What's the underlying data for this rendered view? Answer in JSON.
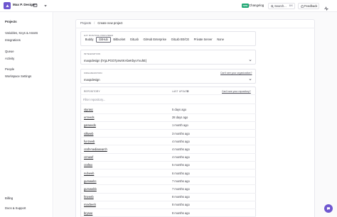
{
  "workspace": {
    "name": "Max P. Design"
  },
  "header": {
    "new_badge": "new",
    "changelog": "Changelog",
    "search_label": "Search...",
    "search_shortcut": "⌘K",
    "feedback": "Feedback"
  },
  "sidebar": {
    "projects": "Projects",
    "variables": "Variables, Keys & Assets",
    "integrations": "Integrations",
    "queue": "Queue",
    "activity": "Activity",
    "people": "People",
    "workspace_settings": "Workspace Settings",
    "billing": "Billing",
    "docs": "Docs & Support"
  },
  "breadcrumb": {
    "parent": "Projects",
    "separator": "/",
    "current": "Create new project"
  },
  "providers_card": {
    "label": "Git hosting provider",
    "options": [
      "Buddy",
      "GitHub",
      "Bitbucket",
      "GitLab",
      "GitHub Enterprise",
      "GitLab EE/CE",
      "Private Server",
      "None"
    ],
    "selected": "GitHub"
  },
  "integration_card": {
    "label": "Integration",
    "value": "maxpdesign (tYgLPGO7prwXKAbeKbyvYxuhE)"
  },
  "organization_card": {
    "label": "Organization",
    "value": "maxpdesign",
    "help_link": "Can't see your organization?"
  },
  "repositories": {
    "col_repo": "Repository",
    "col_updated": "Last update",
    "help_link": "Can't see your repository?",
    "filter_placeholder": "Filter repository...",
    "rows": [
      {
        "name": "styrasc",
        "updated": "5 days ago"
      },
      {
        "name": "urzeeds",
        "updated": "28 days ago"
      },
      {
        "name": "gameeds",
        "updated": "1 month ago"
      },
      {
        "name": "silkweb",
        "updated": "3 months ago"
      },
      {
        "name": "funzweb",
        "updated": "4 months ago"
      },
      {
        "name": "craft-mediasearch",
        "updated": "4 months ago"
      },
      {
        "name": "crmwef",
        "updated": "4 months ago"
      },
      {
        "name": "craftxx",
        "updated": "5 months ago"
      },
      {
        "name": "nubweb",
        "updated": "6 months ago"
      },
      {
        "name": "gumwebc",
        "updated": "7 months ago"
      },
      {
        "name": "gumwebb",
        "updated": "7 months ago"
      },
      {
        "name": "fmeeeb",
        "updated": "8 months ago"
      },
      {
        "name": "maxbeeb",
        "updated": "8 months ago"
      },
      {
        "name": "brysee",
        "updated": "8 months ago"
      }
    ]
  },
  "colors": {
    "accent": "#6e56cf",
    "new_badge": "#1ea672"
  }
}
